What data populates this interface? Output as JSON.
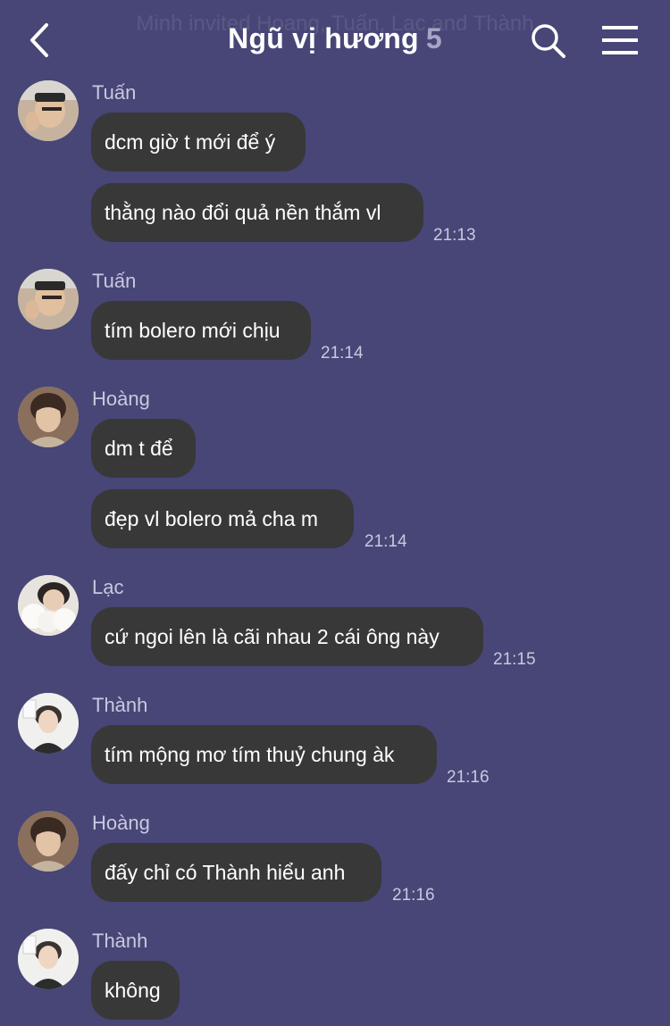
{
  "header": {
    "ghost_text": "Minh invited Hoang, Tuấn, Lạc and Thành",
    "title": "Ngũ vị hương",
    "member_count": "5"
  },
  "messages": [
    {
      "sender": "Tuấn",
      "bubbles": [
        "dcm giờ t mới để ý",
        "thằng nào đổi quả nền thắm vl"
      ],
      "time": "21:13"
    },
    {
      "sender": "Tuấn",
      "bubbles": [
        "tím bolero mới chịu"
      ],
      "time": "21:14"
    },
    {
      "sender": "Hoàng",
      "bubbles": [
        "dm t để",
        "đẹp vl bolero mả cha m"
      ],
      "time": "21:14"
    },
    {
      "sender": "Lạc",
      "bubbles": [
        "cứ ngoi lên là cãi nhau 2 cái ông này"
      ],
      "time": "21:15"
    },
    {
      "sender": "Thành",
      "bubbles": [
        "tím mộng mơ tím thuỷ chung àk"
      ],
      "time": "21:16"
    },
    {
      "sender": "Hoàng",
      "bubbles": [
        "đấy chỉ có Thành hiểu anh"
      ],
      "time": "21:16"
    },
    {
      "sender": "Thành",
      "bubbles": [
        "không"
      ],
      "time": ""
    }
  ],
  "icons": {
    "back": "chevron-left-icon",
    "search": "search-icon",
    "menu": "menu-icon"
  },
  "colors": {
    "background": "#474677",
    "bubble": "#383838",
    "secondary_text": "#c9c8de"
  }
}
